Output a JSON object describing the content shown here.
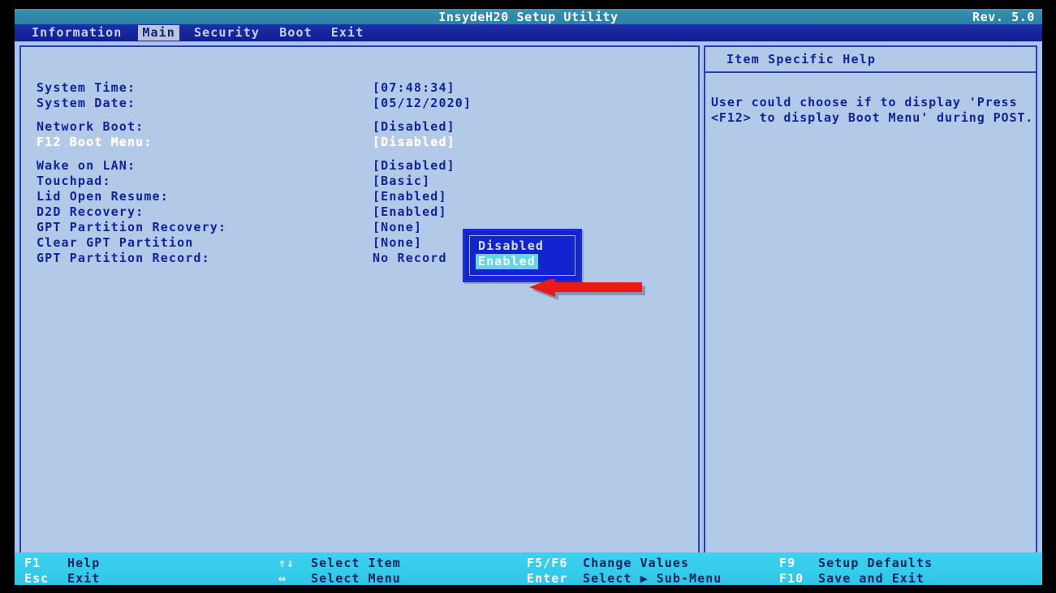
{
  "titlebar": {
    "title": "InsydeH20 Setup Utility",
    "revision": "Rev. 5.0"
  },
  "menubar": {
    "items": [
      {
        "label": "Information",
        "selected": false
      },
      {
        "label": "Main",
        "selected": true
      },
      {
        "label": "Security",
        "selected": false
      },
      {
        "label": "Boot",
        "selected": false
      },
      {
        "label": "Exit",
        "selected": false
      }
    ]
  },
  "main_panel": {
    "rows": [
      {
        "label": "System Time:",
        "value": "[07:48:34]",
        "active": false,
        "gap_after": false
      },
      {
        "label": "System Date:",
        "value": "[05/12/2020]",
        "active": false,
        "gap_after": true
      },
      {
        "label": "Network Boot:",
        "value": "[Disabled]",
        "active": false,
        "gap_after": false
      },
      {
        "label": "F12 Boot Menu:",
        "value": "[Disabled]",
        "active": true,
        "gap_after": true
      },
      {
        "label": "Wake on LAN:",
        "value": "[Disabled]",
        "active": false,
        "gap_after": false
      },
      {
        "label": "Touchpad:",
        "value": "[Basic]",
        "active": false,
        "gap_after": false
      },
      {
        "label": "Lid Open Resume:",
        "value": "[Enabled]",
        "active": false,
        "gap_after": false
      },
      {
        "label": "D2D Recovery:",
        "value": "[Enabled]",
        "active": false,
        "gap_after": false
      },
      {
        "label": "GPT Partition Recovery:",
        "value": "[None]",
        "active": false,
        "gap_after": false
      },
      {
        "label": "Clear GPT Partition",
        "value": "[None]",
        "active": false,
        "gap_after": false
      },
      {
        "label": "GPT Partition Record:",
        "value": "No Record",
        "active": false,
        "gap_after": false
      }
    ]
  },
  "popup": {
    "options": [
      {
        "label": "Disabled",
        "selected": false
      },
      {
        "label": "Enabled",
        "selected": true
      }
    ]
  },
  "annotation": {
    "arrow_color": "#e81b16",
    "points_at": "Enabled"
  },
  "help_panel": {
    "header": "Item Specific Help",
    "lines": [
      "User could choose if to display 'Press",
      "<F12> to display Boot Menu' during POST."
    ]
  },
  "statusbar": {
    "cells": [
      {
        "key": "F1",
        "desc": "Help"
      },
      {
        "key": "Esc",
        "desc": "Exit"
      },
      {
        "key": "⇑⇓",
        "desc": "Select Item"
      },
      {
        "key": "⇔",
        "desc": "Select Menu"
      },
      {
        "key": "F5/F6",
        "desc": "Change Values"
      },
      {
        "key": "Enter",
        "desc": "Select ▶ Sub-Menu"
      },
      {
        "key": "F9",
        "desc": "Setup Defaults"
      },
      {
        "key": "F10",
        "desc": "Save and Exit"
      }
    ]
  },
  "colors": {
    "screen_bezel": "#000000",
    "title_bar": "#2e86aa",
    "menu_bar": "#16249b",
    "panel_background": "#b3c9e8",
    "panel_border": "#2b3fa8",
    "text_blue": "#11239b",
    "popup_background": "#1124cf",
    "popup_highlight": "#5fd7e8",
    "status_bar": "#35cbeb"
  }
}
